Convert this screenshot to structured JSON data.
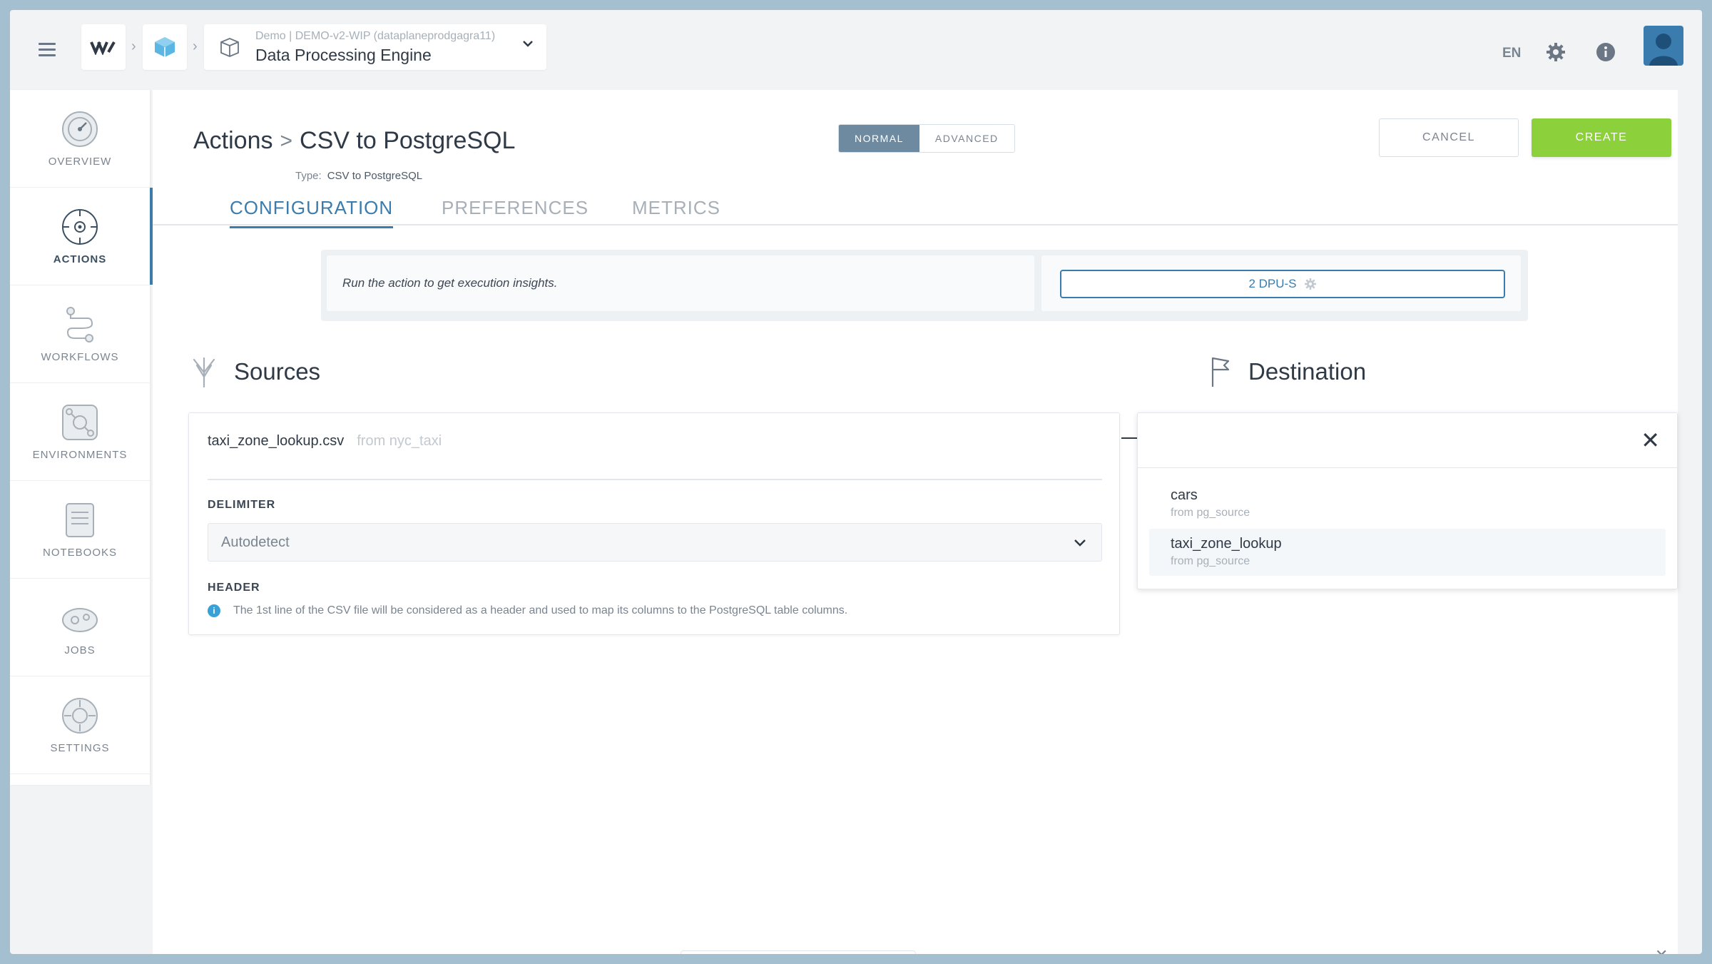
{
  "topbar": {
    "project_sub": "Demo | DEMO-v2-WIP (dataplaneprodgagra11)",
    "project_name": "Data Processing Engine",
    "language": "EN"
  },
  "sidebar": {
    "items": [
      {
        "label": "OVERVIEW",
        "icon": "overview-icon"
      },
      {
        "label": "ACTIONS",
        "icon": "actions-icon"
      },
      {
        "label": "WORKFLOWS",
        "icon": "workflows-icon"
      },
      {
        "label": "ENVIRONMENTS",
        "icon": "environments-icon"
      },
      {
        "label": "NOTEBOOKS",
        "icon": "notebooks-icon"
      },
      {
        "label": "JOBS",
        "icon": "jobs-icon"
      },
      {
        "label": "SETTINGS",
        "icon": "settings-icon"
      }
    ],
    "active": "ACTIONS"
  },
  "header": {
    "breadcrumb_root": "Actions",
    "breadcrumb_sep": ">",
    "action_name": "CSV to PostgreSQL",
    "type_label": "Type:",
    "type_value": "CSV to PostgreSQL",
    "mode_normal": "NORMAL",
    "mode_advanced": "ADVANCED",
    "cancel_label": "CANCEL",
    "create_label": "CREATE"
  },
  "tabs": [
    "CONFIGURATION",
    "PREFERENCES",
    "METRICS"
  ],
  "insights": {
    "message": "Run the action to get execution insights.",
    "dpu_label": "2 DPU-S"
  },
  "sources": {
    "title": "Sources",
    "file": "taxi_zone_lookup.csv",
    "from": "from nyc_taxi",
    "delimiter_label": "DELIMITER",
    "delimiter_value": "Autodetect",
    "header_label": "HEADER",
    "header_info": "The 1st line of the CSV file will be considered as a header and used to map its columns to the PostgreSQL table columns."
  },
  "destination": {
    "title": "Destination",
    "close": "✕",
    "items": [
      {
        "name": "cars",
        "from": "from pg_source"
      },
      {
        "name": "taxi_zone_lookup",
        "from": "from pg_source"
      }
    ]
  },
  "colors": {
    "accent": "#3a7cad",
    "create": "#8cd03c",
    "frame_bg": "#a3bfd0"
  }
}
